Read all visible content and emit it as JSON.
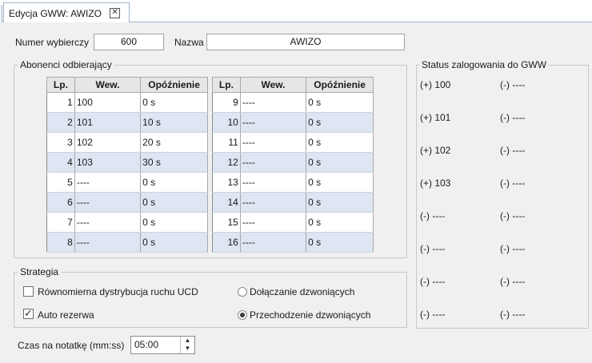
{
  "tab": {
    "title": "Edycja GWW: AWIZO",
    "close_icon": "close-icon"
  },
  "header": {
    "numer_label": "Numer wybierczy",
    "numer_value": "600",
    "nazwa_label": "Nazwa",
    "nazwa_value": "AWIZO"
  },
  "abonenci": {
    "title": "Abonenci odbierający",
    "columns": [
      "Lp.",
      "Wew.",
      "Opóźnienie"
    ],
    "left_rows": [
      {
        "lp": "1",
        "wew": "100",
        "delay": "0 s"
      },
      {
        "lp": "2",
        "wew": "101",
        "delay": "10 s"
      },
      {
        "lp": "3",
        "wew": "102",
        "delay": "20 s"
      },
      {
        "lp": "4",
        "wew": "103",
        "delay": "30 s"
      },
      {
        "lp": "5",
        "wew": "----",
        "delay": "0 s"
      },
      {
        "lp": "6",
        "wew": "----",
        "delay": "0 s"
      },
      {
        "lp": "7",
        "wew": "----",
        "delay": "0 s"
      },
      {
        "lp": "8",
        "wew": "----",
        "delay": "0 s"
      }
    ],
    "right_rows": [
      {
        "lp": "9",
        "wew": "----",
        "delay": "0 s"
      },
      {
        "lp": "10",
        "wew": "----",
        "delay": "0 s"
      },
      {
        "lp": "11",
        "wew": "----",
        "delay": "0 s"
      },
      {
        "lp": "12",
        "wew": "----",
        "delay": "0 s"
      },
      {
        "lp": "13",
        "wew": "----",
        "delay": "0 s"
      },
      {
        "lp": "14",
        "wew": "----",
        "delay": "0 s"
      },
      {
        "lp": "15",
        "wew": "----",
        "delay": "0 s"
      },
      {
        "lp": "16",
        "wew": "----",
        "delay": "0 s"
      }
    ]
  },
  "status": {
    "title": "Status zalogowania do GWW",
    "left": [
      "(+) 100",
      "(+) 101",
      "(+) 102",
      "(+) 103",
      "(-) ----",
      "(-) ----",
      "(-) ----",
      "(-) ----"
    ],
    "right": [
      "(-) ----",
      "(-) ----",
      "(-) ----",
      "(-) ----",
      "(-) ----",
      "(-) ----",
      "(-) ----",
      "(-) ----"
    ]
  },
  "strategia": {
    "title": "Strategia",
    "ucd_label": "Równomierna dystrybucja ruchu UCD",
    "ucd_checked": false,
    "auto_label": "Auto rezerwa",
    "auto_checked": true,
    "dolaczanie_label": "Dołączanie dzwoniących",
    "przechodzenie_label": "Przechodzenie dzwoniących",
    "selected": "Przechodzenie dzwoniących"
  },
  "czas": {
    "label": "Czas na notatkę (mm:ss)",
    "value": "05:00"
  }
}
